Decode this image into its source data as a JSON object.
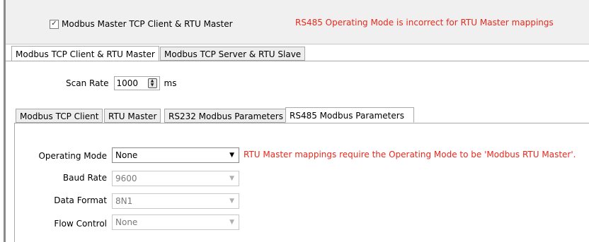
{
  "top": {
    "enable_checkbox_label": "Modbus Master TCP Client & RTU Master",
    "enable_checked": true,
    "error_message": "RS485 Operating Mode is incorrect for RTU Master mappings"
  },
  "outer_tabs": [
    {
      "label": "Modbus TCP Client & RTU Master",
      "active": true
    },
    {
      "label": "Modbus TCP Server & RTU Slave",
      "active": false
    }
  ],
  "scan_rate": {
    "label": "Scan Rate",
    "value": "1000",
    "unit": "ms"
  },
  "inner_tabs": [
    {
      "label": "Modbus TCP Client",
      "active": false
    },
    {
      "label": "RTU Master",
      "active": false
    },
    {
      "label": "RS232 Modbus Parameters",
      "active": false
    },
    {
      "label": "RS485 Modbus Parameters",
      "active": true
    }
  ],
  "form": {
    "operating_mode": {
      "label": "Operating Mode",
      "value": "None"
    },
    "operating_mode_error": "RTU Master mappings require the Operating Mode to be 'Modbus RTU Master'.",
    "baud_rate": {
      "label": "Baud Rate",
      "value": "9600"
    },
    "data_format": {
      "label": "Data Format",
      "value": "8N1"
    },
    "flow_control": {
      "label": "Flow Control",
      "value": "None"
    }
  },
  "colors": {
    "error": "#e8291c",
    "panel": "#f0f0f0",
    "border": "#a8a8a8"
  }
}
